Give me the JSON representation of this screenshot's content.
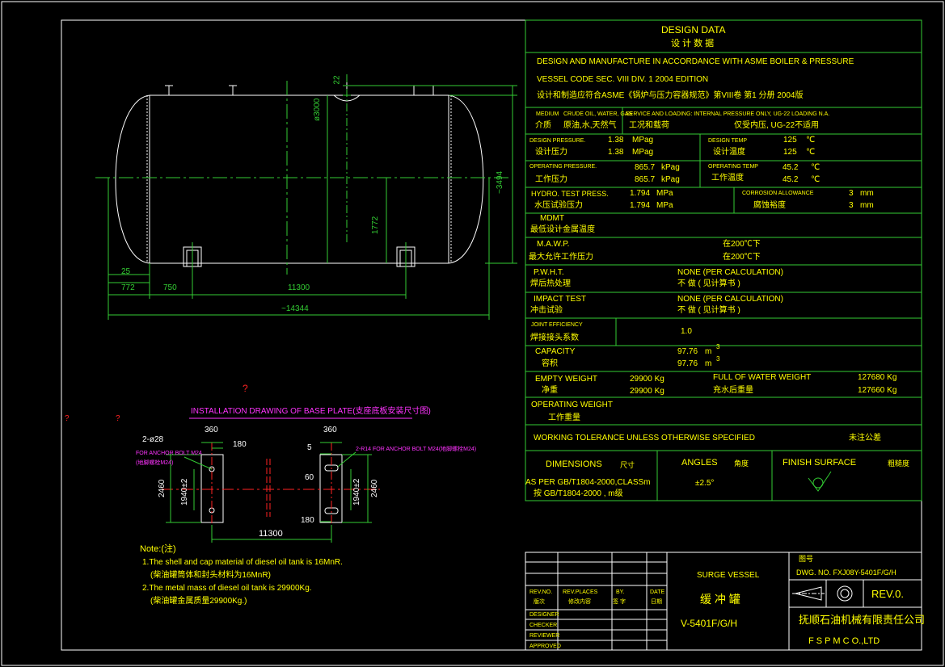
{
  "colors": {
    "background": "#000000",
    "frame": "#ffffff",
    "table_lines": "#33cc33",
    "table_text": "#ffff00",
    "vessel": "#ffffff",
    "centerline": "#33cc33",
    "dimension": "#33cc33",
    "annotation": "#ff33ff",
    "hidden": "#ff2222"
  },
  "design_data": {
    "title_en": "DESIGN DATA",
    "title_cn": "设 计 数 据",
    "line1": "DESIGN AND MANUFACTURE IN ACCORDANCE WITH ASME BOILER & PRESSURE",
    "line2": "VESSEL CODE SEC. VIII DIV. 1 2004 EDITION",
    "line3": "设计和制造应符合ASME《锅炉与压力容器规范》第VIII卷 第1 分册 2004版",
    "medium_label_en": "MEDIUM",
    "medium_value_en": "CRUDE OIL, WATER, GAS",
    "medium_label_cn": "介质",
    "medium_value_cn": "原油,水,天然气",
    "service_label_en": "SERVICE AND LOADING: INTERNAL PRESSURE ONLY, UG-22 LOADING N.A.",
    "service_label_cn": "工况和载荷",
    "service_value_cn": "仅受内压, UG-22不适用",
    "design_pressure_en": "DESIGN PRESSURE.",
    "design_pressure_cn": "设计压力",
    "design_pressure_val1": "1.38",
    "design_pressure_val2": "1.38",
    "design_pressure_unit": "MPag",
    "design_temp_en": "DESIGN TEMP",
    "design_temp_cn": "设计温度",
    "design_temp_val1": "125",
    "design_temp_val2": "125",
    "temp_unit": "℃",
    "operating_pressure_en": "OPERATING PRESSURE.",
    "operating_pressure_cn": "工作压力",
    "operating_pressure_val1": "865.7",
    "operating_pressure_val2": "865.7",
    "operating_pressure_unit": "kPag",
    "operating_temp_en": "OPERATING TEMP",
    "operating_temp_cn": "工作温度",
    "operating_temp_val1": "45.2",
    "operating_temp_val2": "45.2",
    "hydro_en": "HYDRO. TEST PRESS.",
    "hydro_cn": "水压试验压力",
    "hydro_val1": "1.794",
    "hydro_val2": "1.794",
    "hydro_unit": "MPa",
    "corrosion_en": "CORROSION ALLOWANCE",
    "corrosion_cn": "腐蚀裕度",
    "corrosion_val1": "3",
    "corrosion_val2": "3",
    "corrosion_unit": "mm",
    "mdmt_en": "MDMT",
    "mdmt_cn": "最低设计金属温度",
    "mawp_en": "M.A.W.P.",
    "mawp_cn": "最大允许工作压力",
    "mawp_val1": "在200℃下",
    "mawp_val2": "在200℃下",
    "pwht_en": "P.W.H.T.",
    "pwht_cn": "焊后热处理",
    "pwht_val_en": "NONE (PER CALCULATION)",
    "pwht_val_cn": "不  做 ( 见计算书 )",
    "impact_en": "IMPACT TEST",
    "impact_cn": "冲击试验",
    "impact_val_en": "NONE (PER CALCULATION)",
    "impact_val_cn": "不  做 ( 见计算书 )",
    "joint_en": "JOINT EFFICIENCY",
    "joint_cn": "焊接接头系数",
    "joint_val": "1.0",
    "capacity_en": "CAPACITY",
    "capacity_cn": "容积",
    "capacity_val1": "97.76",
    "capacity_val2": "97.76",
    "capacity_unit": "m",
    "capacity_sup": "3",
    "empty_weight_en": "EMPTY WEIGHT",
    "empty_weight_cn": "净重",
    "empty_weight_val1": "29900 Kg",
    "empty_weight_val2": "29900 Kg",
    "full_weight_en": "FULL OF WATER WEIGHT",
    "full_weight_cn": "充水后重量",
    "full_weight_val1": "127680 Kg",
    "full_weight_val2": "127660 Kg",
    "operating_weight_en": "OPERATING WEIGHT",
    "operating_weight_cn": "工作重量",
    "tolerance_en": "WORKING TOLERANCE UNLESS OTHERWISE SPECIFIED",
    "tolerance_cn": "未注公差",
    "dimensions_en": "DIMENSIONS",
    "dimensions_cn": "尺寸",
    "angles_en": "ANGLES",
    "angles_cn": "角度",
    "finish_en": "FINISH SURFACE",
    "finish_cn": "粗糙度",
    "dim_std_en": "AS PER GB/T1804-2000,CLASSm",
    "dim_std_cn": "按 GB/T1804-2000 , m级",
    "angle_val": "±2.5°"
  },
  "vessel_dims": {
    "d22": "22",
    "dia": "ø3000",
    "h3494": "~3494",
    "h1772": "1772",
    "d25": "25",
    "d772": "772",
    "d750": "750",
    "d11300": "11300",
    "d14344": "~14344"
  },
  "base_plate": {
    "title": "INSTALLATION DRAWING OF BASE PLATE(支座底板安装尺寸图)",
    "qmark1": "?",
    "qmark2": "?",
    "qmark3": "?",
    "holes_left": "2-ø28",
    "bolt_left1": "FOR ANCHOR BOLT M24",
    "bolt_left2": "(地脚螺栓M24)",
    "bolt_right": "2-R14 FOR ANCHOR BOLT M24(地脚螺栓M24)",
    "d360a": "360",
    "d180a": "180",
    "d360b": "360",
    "d5": "5",
    "d180b": "180",
    "d60": "60",
    "d180c": "180",
    "d2460a": "2460",
    "d1940a": "1940±2",
    "d1940b": "1940±2",
    "d2460b": "2460",
    "d11300": "11300"
  },
  "notes": {
    "title": "Note:(注)",
    "n1": "1.The shell and cap material of diesel oil tank is 16MnR.",
    "n1cn": "(柴油罐筒体和封头材料为16MnR)",
    "n2": "2.The metal mass of diesel oil tank is 29900Kg.",
    "n2cn": "(柴油罐金属质量29900Kg.)"
  },
  "title_block": {
    "rev_no": "REV.NO.",
    "rev_no_cn": "版次",
    "rev_places": "REV.PLACES",
    "rev_places_cn": "修改内容",
    "by": "BY.",
    "by_cn": "签 字",
    "date": "DATE",
    "date_cn": "日期",
    "designer": "DESIGNER",
    "checker": "CHECKER",
    "reviewer": "REVIEWER",
    "approved": "APPROVED",
    "surge_en": "SURGE VESSEL",
    "surge_cn": "缓 冲 罐",
    "tag": "V-5401F/G/H",
    "dwg_cn": "图号",
    "dwg_no": "DWG. NO.  FXJ08Y-5401F/G/H",
    "rev0": "REV.0.",
    "company_cn": "抚顺石油机械有限责任公司",
    "company_en": "F S P M  C O.,LTD"
  }
}
